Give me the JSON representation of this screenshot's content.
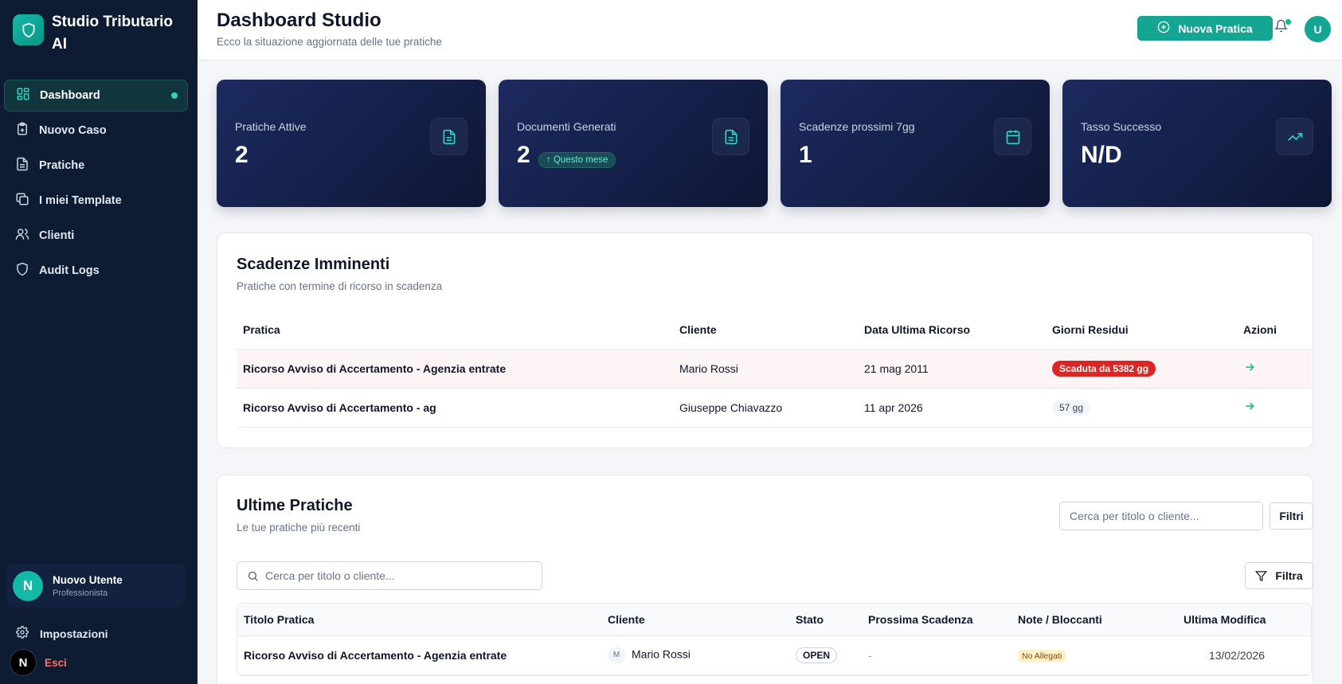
{
  "brand": {
    "name": "Studio Tributario AI"
  },
  "sidebar": {
    "items": [
      {
        "label": "Dashboard",
        "icon": "dashboard-icon"
      },
      {
        "label": "Nuovo Caso",
        "icon": "clipboard-icon"
      },
      {
        "label": "Pratiche",
        "icon": "file-icon"
      },
      {
        "label": "I miei Template",
        "icon": "copy-icon"
      },
      {
        "label": "Clienti",
        "icon": "users-icon"
      },
      {
        "label": "Audit Logs",
        "icon": "shield-icon"
      }
    ],
    "user": {
      "initial": "N",
      "name": "Nuovo Utente",
      "role": "Professionista"
    },
    "settings_label": "Impostazioni",
    "logout_badge": "N",
    "logout_label": "Esci"
  },
  "header": {
    "title": "Dashboard Studio",
    "subtitle": "Ecco la situazione aggiornata delle tue pratiche",
    "new_button": "Nuova Pratica",
    "avatar_initial": "U"
  },
  "stats": [
    {
      "label": "Pratiche Attive",
      "value": "2",
      "icon": "document-icon"
    },
    {
      "label": "Documenti Generati",
      "value": "2",
      "trend": "↑ Questo mese",
      "icon": "document-icon"
    },
    {
      "label": "Scadenze prossimi 7gg",
      "value": "1",
      "icon": "calendar-icon"
    },
    {
      "label": "Tasso Successo",
      "value": "N/D",
      "icon": "trending-up-icon"
    }
  ],
  "deadlines": {
    "title": "Scadenze Imminenti",
    "subtitle": "Pratiche con termine di ricorso in scadenza",
    "columns": [
      "Pratica",
      "Cliente",
      "Data Ultima Ricorso",
      "Giorni Residui",
      "Azioni"
    ],
    "rows": [
      {
        "pratica": "Ricorso Avviso di Accertamento - Agenzia entrate",
        "cliente": "Mario Rossi",
        "data": "21 mag 2011",
        "giorni": "Scaduta da 5382 gg"
      },
      {
        "pratica": "Ricorso Avviso di Accertamento - ag",
        "cliente": "Giuseppe Chiavazzo",
        "data": "11 apr 2026",
        "giorni": "57 gg"
      }
    ]
  },
  "recent": {
    "title": "Ultime Pratiche",
    "subtitle": "Le tue pratiche più recenti",
    "search_placeholder_top": "Cerca per titolo o cliente...",
    "filters_button": "Filtri",
    "search_placeholder": "Cerca per titolo o cliente...",
    "filter_button": "Filtra",
    "columns": [
      "Titolo Pratica",
      "Cliente",
      "Stato",
      "Prossima Scadenza",
      "Note / Bloccanti",
      "Ultima Modifica"
    ],
    "rows": [
      {
        "titolo": "Ricorso Avviso di Accertamento - Agenzia entrate",
        "cliente_initial": "M",
        "cliente": "Mario Rossi",
        "stato": "OPEN",
        "scadenza": "-",
        "note": "No Allegati",
        "modifica": "13/02/2026"
      }
    ]
  }
}
